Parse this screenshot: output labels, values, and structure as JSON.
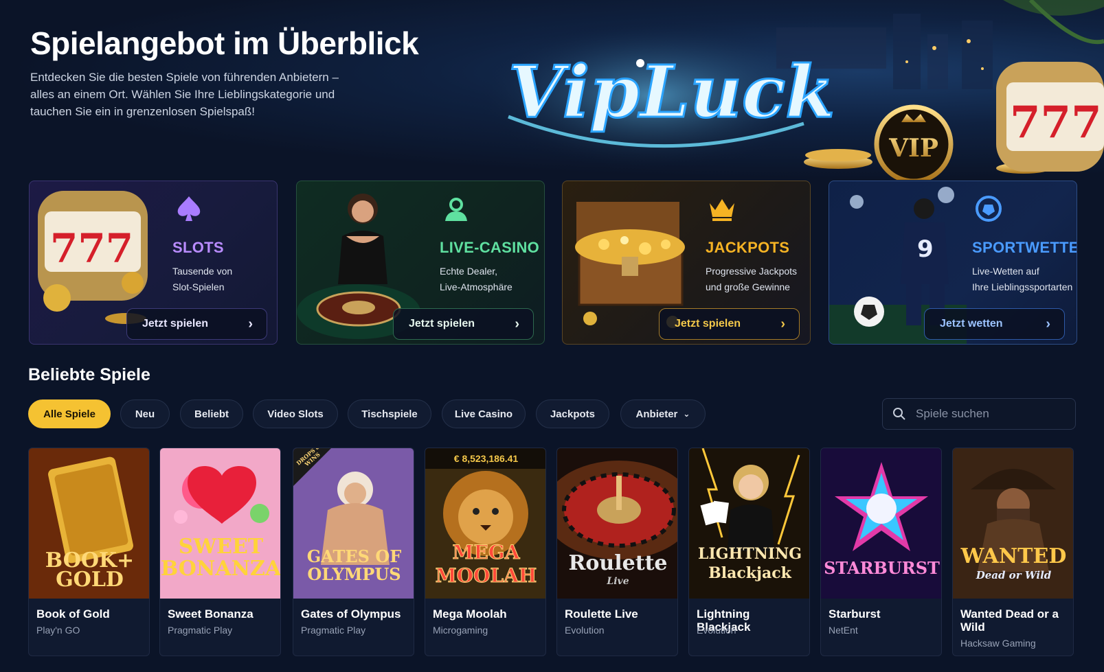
{
  "hero": {
    "title": "Spielangebot im Überblick",
    "description": "Entdecken Sie die besten Spiele von führenden Anbietern – alles an einem Ort. Wählen Sie Ihre Lieblingskategorie und tauchen Sie ein in grenzenlosen Spielspaß!",
    "logo_text": "VipLuck",
    "badge_text": "VIP"
  },
  "categories": [
    {
      "title": "SLOTS",
      "desc_line1": "Tausende von",
      "desc_line2": "Slot-Spielen",
      "button": "Jetzt spielen",
      "icon": "spade-icon",
      "color": "#b98cff",
      "art_text": "777"
    },
    {
      "title": "LIVE-CASINO",
      "desc_line1": "Echte Dealer,",
      "desc_line2": "Live-Atmosphäre",
      "button": "Jetzt spielen",
      "icon": "dealer-icon",
      "color": "#5fe0a0"
    },
    {
      "title": "JACKPOTS",
      "desc_line1": "Progressive Jackpots",
      "desc_line2": "und große Gewinne",
      "button": "Jetzt spielen",
      "icon": "crown-icon",
      "color": "#f5b324"
    },
    {
      "title": "SPORTWETTEN",
      "desc_line1": "Live-Wetten auf",
      "desc_line2": "Ihre Lieblingssportarten",
      "button": "Jetzt wetten",
      "icon": "football-icon",
      "color": "#4a9bff",
      "art_text": "9"
    }
  ],
  "popular": {
    "title": "Beliebte Spiele",
    "filters": [
      "Alle Spiele",
      "Neu",
      "Beliebt",
      "Video Slots",
      "Tischspiele",
      "Live Casino",
      "Jackpots",
      "Anbieter"
    ],
    "active_filter": "Alle Spiele",
    "search_placeholder": "Spiele suchen"
  },
  "games": [
    {
      "name": "Book of Gold",
      "provider": "Play'n GO",
      "art": "BOOK+ GOLD"
    },
    {
      "name": "Sweet Bonanza",
      "provider": "Pragmatic Play",
      "art": "SWEET BONANZA"
    },
    {
      "name": "Gates of Olympus",
      "provider": "Pragmatic Play",
      "art": "GATES OF OLYMPUS",
      "corner": "DROPS & WINS"
    },
    {
      "name": "Mega Moolah",
      "provider": "Microgaming",
      "art": "MEGA MOOLAH",
      "jackpot": "€ 8,523,186.41"
    },
    {
      "name": "Roulette Live",
      "provider": "Evolution",
      "art": "Roulette",
      "art_sub": "Live"
    },
    {
      "name": "Lightning Blackjack",
      "provider": "Evolution",
      "art": "LIGHTNING Blackjack"
    },
    {
      "name": "Starburst",
      "provider": "NetEnt",
      "art": "STARBURST"
    },
    {
      "name": "Wanted Dead or a Wild",
      "provider": "Hacksaw Gaming",
      "art": "WANTED",
      "art_sub": "Dead or Wild"
    }
  ]
}
